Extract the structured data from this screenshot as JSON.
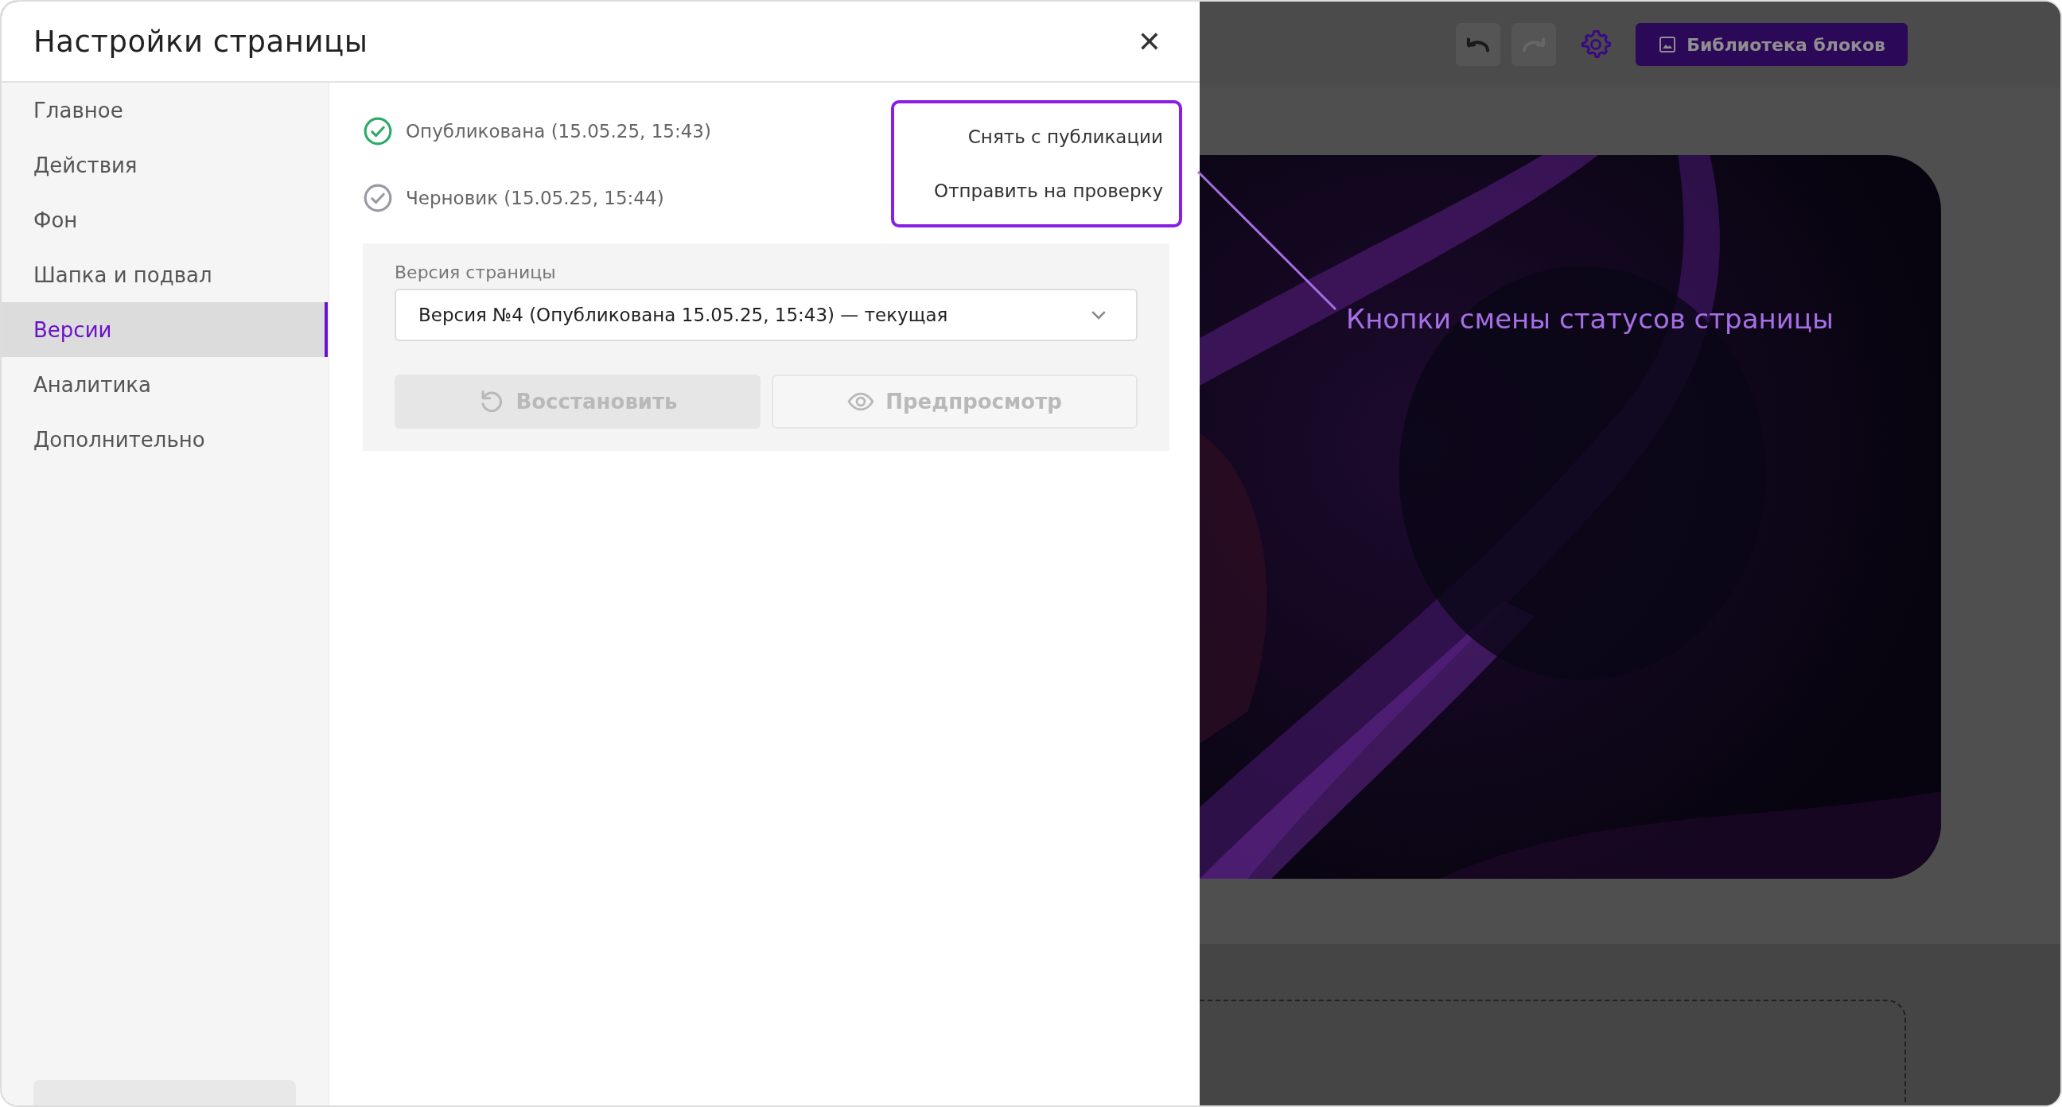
{
  "dialog": {
    "title": "Настройки страницы",
    "close": "✕"
  },
  "sidebar": {
    "items": [
      {
        "label": "Главное",
        "selected": false
      },
      {
        "label": "Действия",
        "selected": false
      },
      {
        "label": "Фон",
        "selected": false
      },
      {
        "label": "Шапка и подвал",
        "selected": false
      },
      {
        "label": "Версии",
        "selected": true
      },
      {
        "label": "Аналитика",
        "selected": false
      },
      {
        "label": "Дополнительно",
        "selected": false
      }
    ]
  },
  "statuses": [
    {
      "label": "Опубликована (15.05.25, 15:43)",
      "active": true
    },
    {
      "label": "Черновик (15.05.25, 15:44)",
      "active": false
    }
  ],
  "status_actions": [
    "Снять с публикации",
    "Отправить на проверку"
  ],
  "version": {
    "label": "Версия страницы",
    "value": "Версия №4 (Опубликована 15.05.25, 15:43) — текущая"
  },
  "buttons": [
    {
      "kind": "restore",
      "label": "Восстановить",
      "disabled": true
    },
    {
      "kind": "preview",
      "label": "Предпросмотр",
      "disabled": true
    }
  ],
  "toolbar": {
    "buttons": [
      {
        "kind": "undo",
        "disabled": false
      },
      {
        "kind": "redo",
        "disabled": true
      },
      {
        "kind": "settings",
        "disabled": false
      }
    ],
    "library": "Библиотека блоков"
  },
  "annotation": "Кнопки смены статусов страницы"
}
